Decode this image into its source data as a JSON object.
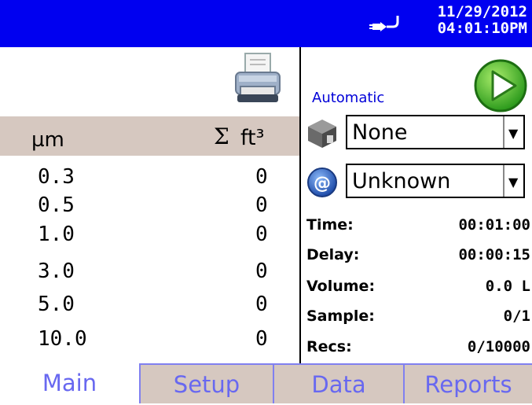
{
  "status_bar": {
    "date": "11/29/2012",
    "time": "04:01:10PM",
    "power_icon": "plug-icon"
  },
  "left_panel": {
    "printer_icon": "printer-icon",
    "header": {
      "size_unit": "µm",
      "sum_symbol": "Σ",
      "count_unit": "ft³"
    },
    "rows": [
      {
        "size": "0.3",
        "count": "0"
      },
      {
        "size": "0.5",
        "count": "0"
      },
      {
        "size": "1.0",
        "count": "0"
      },
      {
        "size": "3.0",
        "count": "0"
      },
      {
        "size": "5.0",
        "count": "0"
      },
      {
        "size": "10.0",
        "count": "0"
      }
    ]
  },
  "right_panel": {
    "mode_label": "Automatic",
    "start_icon": "play-icon",
    "location_select": {
      "icon": "building-icon",
      "value": "None"
    },
    "email_select": {
      "icon": "at-icon",
      "value": "Unknown"
    },
    "stats": [
      {
        "label": "Time:",
        "value": "00:01:00"
      },
      {
        "label": "Delay:",
        "value": "00:00:15"
      },
      {
        "label": "Volume:",
        "value": "0.0 L"
      },
      {
        "label": "Sample:",
        "value": "0/1"
      },
      {
        "label": "Recs:",
        "value": "0/10000"
      }
    ]
  },
  "tabs": [
    {
      "label": "Main",
      "active": true
    },
    {
      "label": "Setup",
      "active": false
    },
    {
      "label": "Data",
      "active": false
    },
    {
      "label": "Reports",
      "active": false
    }
  ],
  "colors": {
    "status_bar_bg": "#0000f0",
    "header_bg": "#d6c8c0",
    "tab_text": "#6868f0",
    "mode_text": "#0000d8"
  }
}
